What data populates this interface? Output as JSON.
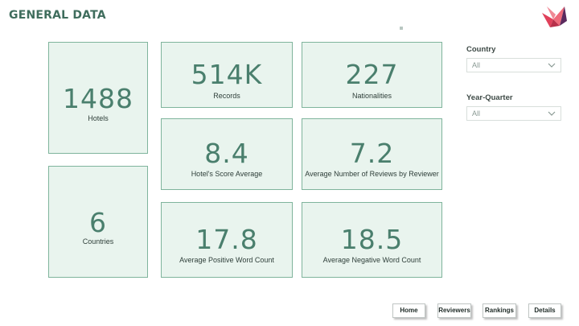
{
  "page": {
    "title": "GENERAL DATA"
  },
  "cards": {
    "hotels": {
      "value": "1488",
      "label": "Hotels"
    },
    "countries": {
      "value": "6",
      "label": "Countries"
    },
    "records": {
      "value": "514K",
      "label": "Records"
    },
    "nationalities": {
      "value": "227",
      "label": "Nationalities"
    },
    "score_avg": {
      "value": "8.4",
      "label": "Hotel's Score Average"
    },
    "reviews_by_reviewer": {
      "value": "7.2",
      "label": "Average Number of Reviews by Reviewer"
    },
    "pos_words": {
      "value": "17.8",
      "label": "Average Positive Word Count"
    },
    "neg_words": {
      "value": "18.5",
      "label": "Average Negative Word Count"
    }
  },
  "filters": {
    "country": {
      "label": "Country",
      "value": "All"
    },
    "year_quarter": {
      "label": "Year-Quarter",
      "value": "All"
    }
  },
  "nav": {
    "home": "Home",
    "reviewers": "Reviewers",
    "rankings": "Rankings",
    "details": "Details"
  },
  "colors": {
    "card_bg": "#e9f4ee",
    "card_border": "#7fb49c",
    "value_text": "#4a7f6d",
    "title_text": "#3f6d5d",
    "logo_red": "#e0405a",
    "logo_purple": "#5b2a5e"
  },
  "icons": {
    "logo": "origami-bird-logo",
    "dropdown": "chevron-down-icon"
  }
}
